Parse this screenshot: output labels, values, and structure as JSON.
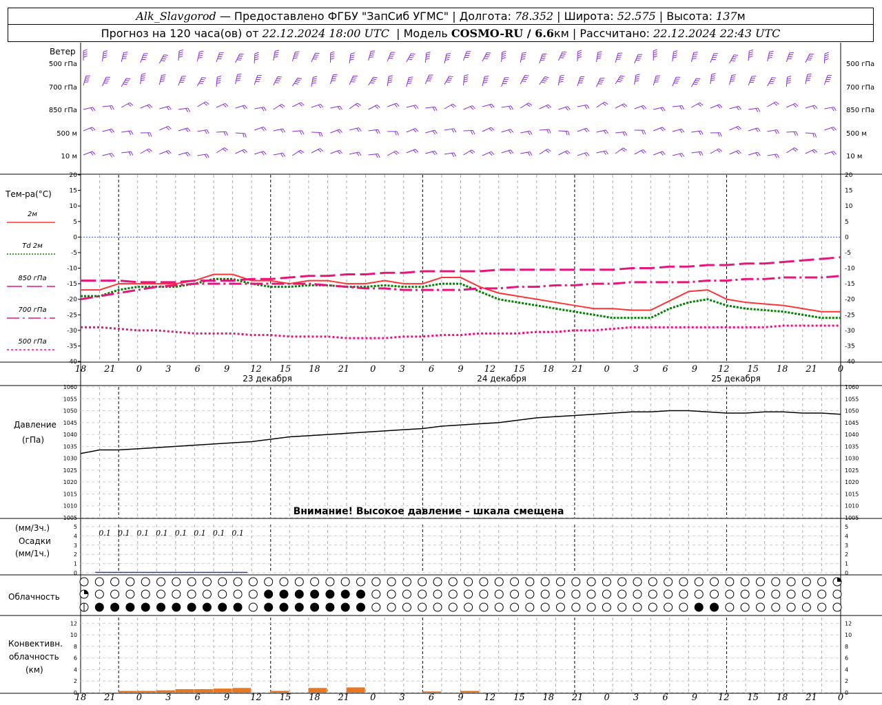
{
  "header": {
    "station": "Alk_Slavgorod",
    "provider": "— Предоставлено ФГБУ \"ЗапСиб УГМС\" |",
    "lon_label": "Долгота:",
    "lon": "78.352",
    "lat_label": "| Широта:",
    "lat": "52.575",
    "alt_label": "| Высота:",
    "alt": "137",
    "alt_unit": "м",
    "forecast_label": "Прогноз на 120 часа(ов) от",
    "forecast_start": "22.12.2024 18:00 UTC",
    "model_label": "| Модель",
    "model": "COSMO-RU / 6.6",
    "model_unit": "км",
    "calc_label": "| Рассчитано:",
    "calc_time": "22.12.2024 22:43 UTC"
  },
  "x_axis": {
    "hour_labels": [
      "18",
      "21",
      "0",
      "3",
      "6",
      "9",
      "12",
      "15",
      "18",
      "21",
      "0",
      "3",
      "6",
      "9",
      "12",
      "15",
      "18",
      "21",
      "0",
      "3",
      "6",
      "9",
      "12",
      "15",
      "18",
      "21",
      "0"
    ],
    "day_labels": [
      "23 декабря",
      "24 декабря",
      "25 декабря"
    ]
  },
  "wind": {
    "title": "Ветер",
    "levels": [
      "500 гПа",
      "700 гПа",
      "850 гПа",
      "500 м",
      "10  м"
    ],
    "color": "#8a2be2"
  },
  "temperature": {
    "title": "Тем-ра(°С)",
    "legend": [
      {
        "label": "2м",
        "color": "#ff3333",
        "style": "solid"
      },
      {
        "label": "Td  2м",
        "color": "#008000",
        "style": "dotted"
      },
      {
        "label": "850 гПа",
        "color": "#e8147c",
        "style": "longdash"
      },
      {
        "label": "700 гПа",
        "color": "#e8147c",
        "style": "dashdot"
      },
      {
        "label": "500 гПа",
        "color": "#e8147c",
        "style": "shortdash"
      }
    ],
    "ticks": [
      "20",
      "15",
      "10",
      "5",
      "0",
      "-5",
      "-10",
      "-15",
      "-20",
      "-25",
      "-30",
      "-35",
      "-40"
    ]
  },
  "pressure": {
    "title1": "Давление",
    "title2": "(гПа)",
    "ticks": [
      "1060",
      "1055",
      "1050",
      "1045",
      "1040",
      "1035",
      "1030",
      "1025",
      "1020",
      "1015",
      "1010",
      "1005"
    ],
    "warning": "Внимание! Высокое давление – шкала смещена"
  },
  "precip": {
    "title1": "(мм/3ч.)",
    "title2": "Осадки",
    "title3": "(мм/1ч.)",
    "ticks": [
      "5",
      "4",
      "3",
      "2",
      "1",
      "0"
    ],
    "amounts": [
      "0.1",
      "0.1",
      "0.1",
      "0.1",
      "0.1",
      "0.1",
      "0.1",
      "0.1"
    ]
  },
  "cloud": {
    "title": "Облачность"
  },
  "convective": {
    "title1": "Конвективн.",
    "title2": "облачность",
    "title3": "(км)",
    "ticks": [
      "12",
      "10",
      "8",
      "6",
      "4",
      "2",
      "0"
    ],
    "color": "#e87722"
  },
  "chart_data": [
    {
      "type": "line",
      "name": "temperature",
      "x_hours": [
        0,
        3,
        6,
        9,
        12,
        15,
        18,
        21,
        24,
        27,
        30,
        33,
        36,
        39,
        42,
        45,
        48,
        51,
        54,
        57,
        60,
        63,
        66,
        69,
        72,
        75,
        78,
        81,
        84,
        87,
        90,
        93,
        96,
        99,
        102,
        105,
        108,
        111,
        114,
        117,
        120
      ],
      "ylim": [
        -40,
        20
      ],
      "series": [
        {
          "name": "2м",
          "values": [
            -17,
            -17,
            -15,
            -15,
            -15,
            -15,
            -14,
            -12,
            -12,
            -14,
            -14,
            -15,
            -14,
            -14,
            -15,
            -15,
            -14,
            -15,
            -15,
            -13,
            -13,
            -16,
            -18,
            -19,
            -20,
            -21,
            -22,
            -23,
            -23,
            -23.5,
            -23.5,
            -20.5,
            -17.5,
            -17,
            -20,
            -21,
            -21.5,
            -22,
            -23,
            -24,
            -24
          ]
        },
        {
          "name": "Td  2м",
          "values": [
            -19,
            -19,
            -17,
            -16,
            -16,
            -16,
            -15,
            -13.5,
            -13.5,
            -15,
            -16,
            -16,
            -15.5,
            -15.5,
            -16,
            -16,
            -15.5,
            -16,
            -16,
            -15,
            -15,
            -17.5,
            -20,
            -21,
            -22,
            -23,
            -24,
            -25,
            -26,
            -26,
            -26,
            -23,
            -21,
            -20,
            -22,
            -23,
            -23.5,
            -24,
            -25,
            -26,
            -26
          ]
        },
        {
          "name": "850 гПа",
          "values": [
            -14,
            -14,
            -14,
            -14.5,
            -14.5,
            -14.5,
            -14,
            -14,
            -14,
            -13.5,
            -13.5,
            -13,
            -12.5,
            -12.5,
            -12,
            -12,
            -11.5,
            -11.5,
            -11,
            -11,
            -11,
            -11,
            -10.5,
            -10.5,
            -10.5,
            -10.5,
            -10.5,
            -10.5,
            -10.5,
            -10,
            -10,
            -9.5,
            -9.5,
            -9,
            -9,
            -8.5,
            -8.5,
            -8,
            -7.5,
            -7,
            -6.5
          ]
        },
        {
          "name": "700 гПа",
          "values": [
            -20,
            -19,
            -18,
            -17,
            -16,
            -15.5,
            -15,
            -15,
            -15,
            -15,
            -15,
            -15,
            -15,
            -15.5,
            -16,
            -16.5,
            -16.5,
            -17,
            -17,
            -17,
            -17,
            -16.5,
            -16.5,
            -16,
            -16,
            -15.5,
            -15.5,
            -15,
            -15,
            -14.5,
            -14.5,
            -14.5,
            -14.5,
            -14,
            -14,
            -13.5,
            -13.5,
            -13,
            -13,
            -13,
            -12.5
          ]
        },
        {
          "name": "500 гПа",
          "values": [
            -29,
            -29,
            -29.5,
            -30,
            -30,
            -30.5,
            -31,
            -31,
            -31,
            -31.5,
            -31.5,
            -32,
            -32,
            -32,
            -32.5,
            -32.5,
            -32.5,
            -32,
            -32,
            -31.5,
            -31.5,
            -31,
            -31,
            -31,
            -30.5,
            -30.5,
            -30,
            -30,
            -29.5,
            -29,
            -29,
            -29,
            -29,
            -29,
            -29,
            -29,
            -29,
            -28.5,
            -28.5,
            -28.5,
            -28.5
          ]
        }
      ]
    },
    {
      "type": "line",
      "name": "pressure",
      "x_hours": [
        0,
        3,
        6,
        9,
        12,
        15,
        18,
        21,
        24,
        27,
        30,
        33,
        36,
        39,
        42,
        45,
        48,
        51,
        54,
        57,
        60,
        63,
        66,
        69,
        72,
        75,
        78,
        81,
        84,
        87,
        90,
        93,
        96,
        99,
        102,
        105,
        108,
        111,
        114,
        117,
        120
      ],
      "ylim": [
        1005,
        1060
      ],
      "series": [
        {
          "name": "Давление",
          "values": [
            1032,
            1033.5,
            1033.5,
            1034,
            1034.5,
            1035,
            1035.5,
            1036,
            1036.5,
            1037,
            1038,
            1039,
            1039.5,
            1040,
            1040.5,
            1041,
            1041.5,
            1042,
            1042.5,
            1043.5,
            1044,
            1044.5,
            1045,
            1046,
            1047,
            1047.5,
            1048,
            1048.5,
            1049,
            1049.5,
            1049.5,
            1050,
            1050,
            1049.5,
            1049,
            1049,
            1049.5,
            1049.5,
            1049,
            1049,
            1048.5
          ]
        }
      ]
    },
    {
      "type": "bar",
      "name": "precipitation",
      "x_hours": [
        6,
        9,
        12,
        15,
        18,
        21,
        24,
        27
      ],
      "ylim": [
        0,
        5
      ],
      "values": [
        0.1,
        0.1,
        0.1,
        0.1,
        0.1,
        0.1,
        0.1,
        0.1
      ]
    },
    {
      "type": "bar",
      "name": "convective_cloud",
      "x_hours": [
        6,
        9,
        12,
        15,
        18,
        21,
        24,
        27,
        30,
        33,
        36,
        39,
        42,
        45,
        48,
        51,
        54,
        57,
        60,
        63
      ],
      "ylim": [
        0,
        13
      ],
      "values": [
        0,
        0.3,
        0.3,
        0.4,
        0.6,
        0.6,
        0.7,
        0.8,
        0,
        0.3,
        0,
        0.8,
        0,
        0.9,
        0,
        0,
        0,
        0.2,
        0,
        0.3
      ]
    }
  ]
}
